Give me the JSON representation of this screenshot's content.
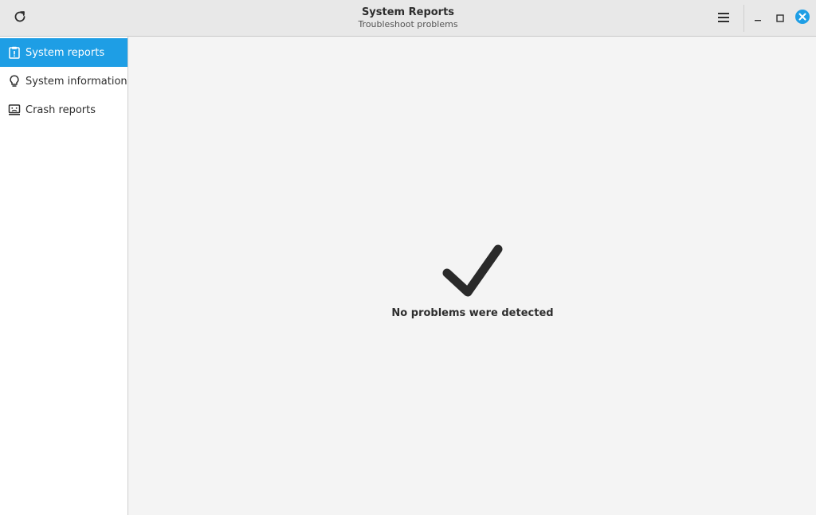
{
  "window": {
    "title": "System Reports",
    "subtitle": "Troubleshoot problems"
  },
  "headerbar": {
    "refresh_icon": "refresh-icon",
    "menu_icon": "hamburger-menu-icon",
    "window_controls": [
      "minimize-icon",
      "maximize-icon",
      "close-icon"
    ],
    "close_color": "#1e9ee5"
  },
  "sidebar": {
    "items": [
      {
        "label": "System reports",
        "icon": "clipboard-icon",
        "active": true
      },
      {
        "label": "System information",
        "icon": "lightbulb-icon",
        "active": false
      },
      {
        "label": "Crash reports",
        "icon": "sad-computer-icon",
        "active": false
      }
    ],
    "accent": "#1e9ee5"
  },
  "main": {
    "status_icon": "checkmark-icon",
    "status_text": "No problems were detected"
  }
}
